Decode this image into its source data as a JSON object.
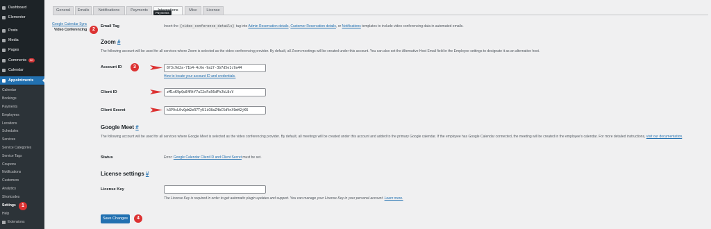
{
  "sidebar": {
    "items": [
      {
        "label": "Dashboard",
        "icon": "dashboard-icon"
      },
      {
        "label": "Elementor",
        "icon": "elementor-icon"
      },
      {
        "label": "Posts",
        "icon": "pin-icon"
      },
      {
        "label": "Media",
        "icon": "media-icon"
      },
      {
        "label": "Pages",
        "icon": "page-icon"
      },
      {
        "label": "Comments",
        "icon": "comment-icon",
        "badge": "50"
      },
      {
        "label": "Calendar",
        "icon": "calendar-icon"
      },
      {
        "label": "Appointments",
        "icon": "appointments-icon"
      }
    ],
    "submenu": [
      "Calendar",
      "Bookings",
      "Payments",
      "Employees",
      "Locations",
      "Schedules",
      "Services",
      "Service Categories",
      "Service Tags",
      "Coupons",
      "Notifications",
      "Customers",
      "Analytics",
      "Shortcodes",
      "Settings",
      "Help",
      "Extensions"
    ],
    "current_sub": "Settings"
  },
  "tabs": [
    "General",
    "Emails",
    "Notifications",
    "Payments",
    "Integrations",
    "Misc",
    "License"
  ],
  "active_tab": "Integrations",
  "tooltip": "Payments",
  "subnav": {
    "link": "Google Calendar Sync",
    "current": "Video Conferencing"
  },
  "email_tag": {
    "label": "Email Tag",
    "text_before": "Insert the",
    "tag": "{video_conference_details}",
    "text_mid": "tag into",
    "link1": "Admin Reservation details",
    "link2": "Customer Reservation details",
    "text_or": ", or",
    "link3": "Notifications",
    "text_after": "templates to include video conferencing data in automated emails."
  },
  "zoom": {
    "title": "Zoom",
    "help": "#",
    "description": "The following account will be used for all services where Zoom is selected as the video conferencing provider. By default, all Zoom meetings will be created under this account. You can also set the Alternative Host Email field in the Employee settings to designate it as an alternative host.",
    "account_id_label": "Account ID",
    "account_id": "8f3c9d2a-71b4-4c6e-9a2f-3b7d5e1c9a44",
    "locate_link": "How to locate your account ID and credentials.",
    "client_id_label": "Client ID",
    "client_id": "zM1xK9pQwE4RtY7uI2oPa56dFhJkL8cV",
    "client_secret_label": "Client Secret",
    "client_secret": "k3P9sL0vQpW2eR7TyU1iO8aZ4bC5dVnX9mH2jK6"
  },
  "google_meet": {
    "title": "Google Meet",
    "help": "#",
    "description": "The following account will be used for all services where Google Meet is selected as the video conferencing provider. By default, all meetings will be created under this account and added to the primary Google calendar. If the employee has Google Calendar connected, the meeting will be created in the employee's calendar. For more detailed instructions,",
    "desc_link": "visit our documentation",
    "desc_end": ".",
    "status_label": "Status",
    "status_prefix": "Error:",
    "status_link": "Google Calendar Client ID and Client Secret",
    "status_suffix": "must be set."
  },
  "license": {
    "title": "License settings",
    "help": "#",
    "key_label": "License Key",
    "key_value": "",
    "note": "The License Key is required in order to get automatic plugin updates and support. You can manage your License Key in your personal account.",
    "note_link": "Learn more."
  },
  "save_label": "Save Changes",
  "markers": [
    "1",
    "2",
    "3",
    "4"
  ],
  "colors": {
    "accent": "#2271b1",
    "marker": "#dc3232",
    "sidebar": "#1d2327"
  }
}
